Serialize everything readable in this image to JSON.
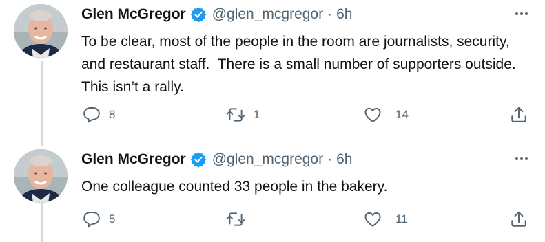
{
  "tweets": [
    {
      "author_name": "Glen McGregor",
      "handle": "@glen_mcgregor",
      "separator": "·",
      "time": "6h",
      "text": "To be clear, most of the people in the room are journalists, security, and restaurant staff.  There is a small number of supporters outside. This isn’t a rally.",
      "replies": "8",
      "retweets": "1",
      "likes": "14"
    },
    {
      "author_name": "Glen McGregor",
      "handle": "@glen_mcgregor",
      "separator": "·",
      "time": "6h",
      "text": "One colleague counted 33 people in the bakery.",
      "replies": "5",
      "retweets": "",
      "likes": "11"
    }
  ],
  "icons": {
    "verified": "verified-badge-icon",
    "more": "more-options-icon",
    "reply": "reply-icon",
    "retweet": "retweet-icon",
    "like": "like-icon",
    "share": "share-icon"
  },
  "colors": {
    "verified": "#1d9bf0",
    "text": "#0f1419",
    "muted": "#536471",
    "thread_line": "#cfd9de"
  }
}
